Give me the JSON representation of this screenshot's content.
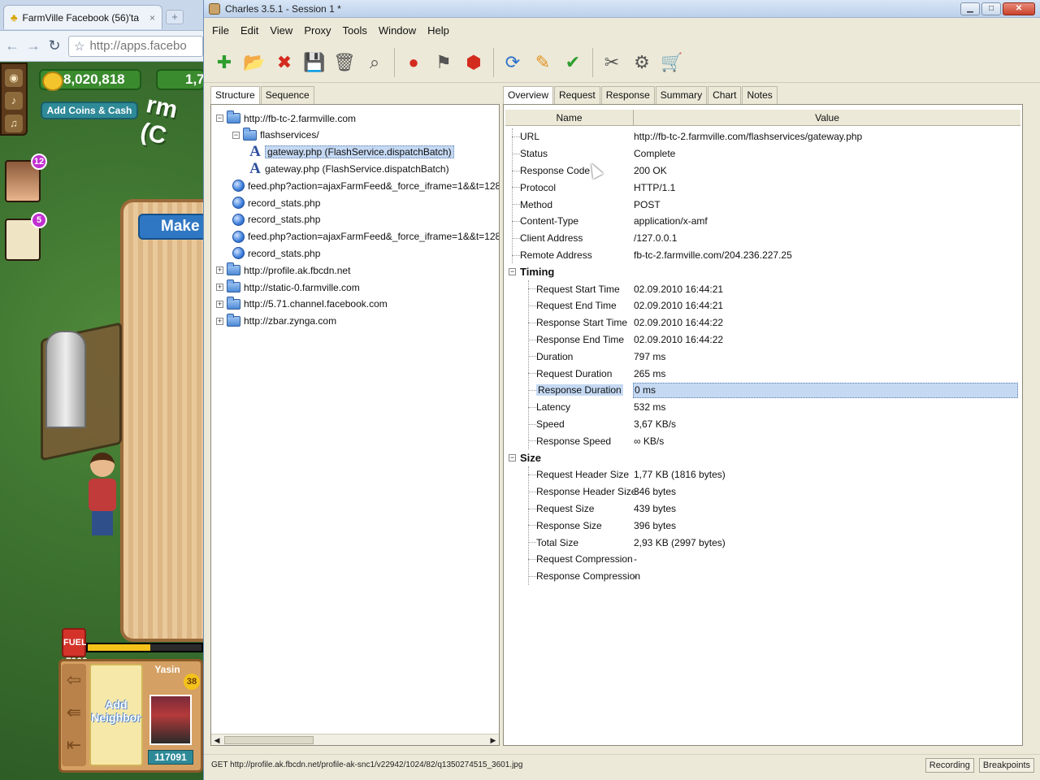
{
  "browser": {
    "tab_title": "FarmVille Facebook (56)'ta",
    "tab_close": "×",
    "new_tab": "+",
    "url": "http://apps.facebo",
    "game": {
      "coins": "8,020,818",
      "cash": "1,7",
      "add_coins_cash": "Add Coins & Cash",
      "farm_title": "rm (C",
      "friend_count_1": "12",
      "friend_count_2": "5",
      "make_label": "Make",
      "fuel_label": "FUEL",
      "fuel_value": "+7999",
      "fuel_level": 0.55,
      "add_neighbor": "Add Neighbor",
      "neighbor_name": "Yasin",
      "neighbor_level": "38",
      "neighbor_score": "117091"
    }
  },
  "charles": {
    "window_title": "Charles 3.5.1 - Session 1 *",
    "menu": [
      "File",
      "Edit",
      "View",
      "Proxy",
      "Tools",
      "Window",
      "Help"
    ],
    "left_tabs": [
      "Structure",
      "Sequence"
    ],
    "tree": [
      {
        "level": 0,
        "icon": "folder",
        "expanded": true,
        "label": "http://fb-tc-2.farmville.com"
      },
      {
        "level": 1,
        "icon": "folder",
        "expanded": true,
        "label": "flashservices/"
      },
      {
        "level": 2,
        "icon": "amf",
        "label": "gateway.php (FlashService.dispatchBatch)",
        "selected": true
      },
      {
        "level": 2,
        "icon": "amf",
        "label": "gateway.php (FlashService.dispatchBatch)"
      },
      {
        "level": 1,
        "icon": "http",
        "label": "feed.php?action=ajaxFarmFeed&_force_iframe=1&&t=128"
      },
      {
        "level": 1,
        "icon": "http",
        "label": "record_stats.php"
      },
      {
        "level": 1,
        "icon": "http",
        "label": "record_stats.php"
      },
      {
        "level": 1,
        "icon": "http",
        "label": "feed.php?action=ajaxFarmFeed&_force_iframe=1&&t=128"
      },
      {
        "level": 1,
        "icon": "http",
        "label": "record_stats.php"
      },
      {
        "level": 0,
        "icon": "folder",
        "expanded": false,
        "label": "http://profile.ak.fbcdn.net"
      },
      {
        "level": 0,
        "icon": "folder",
        "expanded": false,
        "label": "http://static-0.farmville.com"
      },
      {
        "level": 0,
        "icon": "folder",
        "expanded": false,
        "label": "http://5.71.channel.facebook.com"
      },
      {
        "level": 0,
        "icon": "folder",
        "expanded": false,
        "label": "http://zbar.zynga.com"
      }
    ],
    "right_tabs": [
      "Overview",
      "Request",
      "Response",
      "Summary",
      "Chart",
      "Notes"
    ],
    "columns": {
      "name": "Name",
      "value": "Value"
    },
    "overview_rows": [
      {
        "indent": 1,
        "name": "URL",
        "value": "http://fb-tc-2.farmville.com/flashservices/gateway.php"
      },
      {
        "indent": 1,
        "name": "Status",
        "value": "Complete"
      },
      {
        "indent": 1,
        "name": "Response Code",
        "value": "200 OK"
      },
      {
        "indent": 1,
        "name": "Protocol",
        "value": "HTTP/1.1"
      },
      {
        "indent": 1,
        "name": "Method",
        "value": "POST"
      },
      {
        "indent": 1,
        "name": "Content-Type",
        "value": "application/x-amf"
      },
      {
        "indent": 1,
        "name": "Client Address",
        "value": "/127.0.0.1"
      },
      {
        "indent": 1,
        "name": "Remote Address",
        "value": "fb-tc-2.farmville.com/204.236.227.25"
      },
      {
        "indent": 0,
        "name": "Timing",
        "value": "",
        "section": true
      },
      {
        "indent": 2,
        "name": "Request Start Time",
        "value": "02.09.2010 16:44:21"
      },
      {
        "indent": 2,
        "name": "Request End Time",
        "value": "02.09.2010 16:44:21"
      },
      {
        "indent": 2,
        "name": "Response Start Time",
        "value": "02.09.2010 16:44:22"
      },
      {
        "indent": 2,
        "name": "Response End Time",
        "value": "02.09.2010 16:44:22"
      },
      {
        "indent": 2,
        "name": "Duration",
        "value": "797 ms"
      },
      {
        "indent": 2,
        "name": "Request Duration",
        "value": "265 ms"
      },
      {
        "indent": 2,
        "name": "Response Duration",
        "value": "0 ms",
        "selected": true
      },
      {
        "indent": 2,
        "name": "Latency",
        "value": "532 ms"
      },
      {
        "indent": 2,
        "name": "Speed",
        "value": "3,67 KB/s"
      },
      {
        "indent": 2,
        "name": "Response Speed",
        "value": "∞ KB/s"
      },
      {
        "indent": 0,
        "name": "Size",
        "value": "",
        "section": true
      },
      {
        "indent": 2,
        "name": "Request Header Size",
        "value": "1,77 KB (1816 bytes)"
      },
      {
        "indent": 2,
        "name": "Response Header Size",
        "value": "346 bytes"
      },
      {
        "indent": 2,
        "name": "Request Size",
        "value": "439 bytes"
      },
      {
        "indent": 2,
        "name": "Response Size",
        "value": "396 bytes"
      },
      {
        "indent": 2,
        "name": "Total Size",
        "value": "2,93 KB (2997 bytes)"
      },
      {
        "indent": 2,
        "name": "Request Compression",
        "value": "-"
      },
      {
        "indent": 2,
        "name": "Response Compression",
        "value": "-"
      }
    ],
    "status_text": "GET http://profile.ak.fbcdn.net/profile-ak-snc1/v22942/1024/82/q1350274515_3601.jpg",
    "status_buttons": [
      "Recording",
      "Breakpoints"
    ],
    "toolbar_icons": [
      "new-session-icon",
      "open-icon",
      "close-session-icon",
      "save-icon",
      "clear-icon",
      "find-icon",
      "record-icon",
      "throttle-icon",
      "breakpoints-icon",
      "repeat-icon",
      "edit-icon",
      "validate-icon",
      "tools-icon",
      "settings-icon",
      "cart-icon"
    ]
  }
}
